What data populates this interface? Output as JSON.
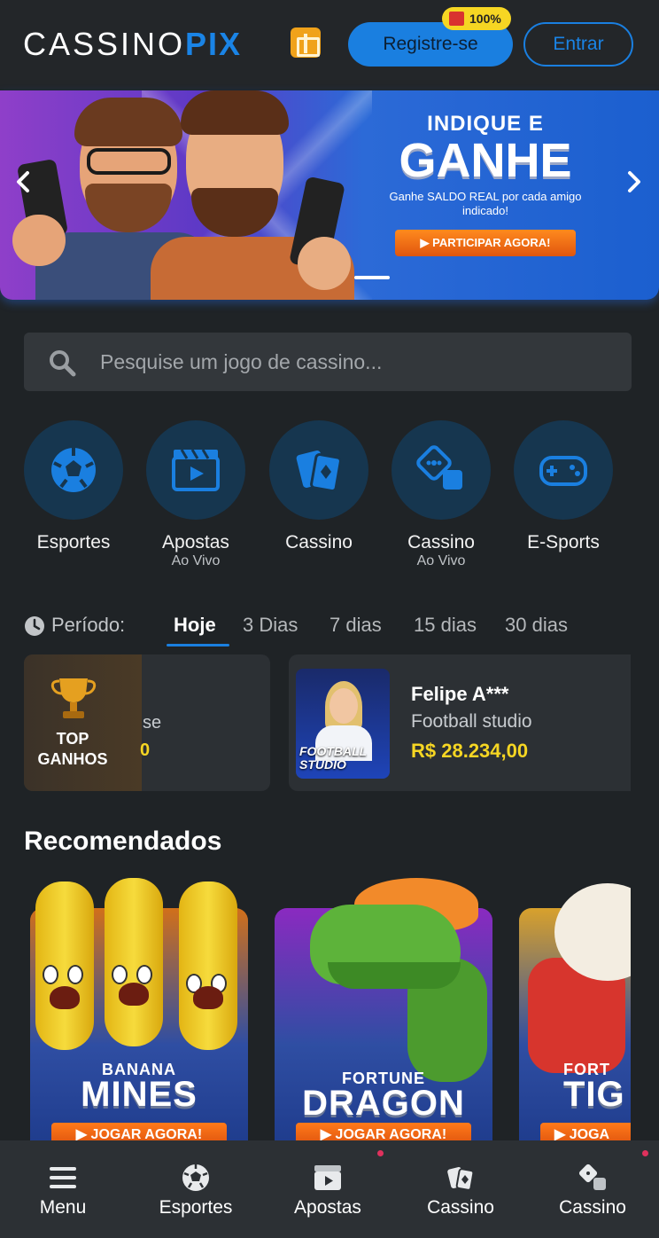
{
  "header": {
    "logo_part1": "CASSINO",
    "logo_part2": "PIX",
    "register_label": "Registre-se",
    "register_badge": "100%",
    "login_label": "Entrar"
  },
  "banner": {
    "title_line1": "INDIQUE E",
    "title_line2": "GANHE",
    "subtitle": "Ganhe SALDO REAL por cada amigo indicado!",
    "cta": "▶ PARTICIPAR AGORA!"
  },
  "search": {
    "placeholder": "Pesquise um jogo de cassino..."
  },
  "categories": [
    {
      "label": "Esportes",
      "sub": "",
      "icon": "soccer-ball-icon"
    },
    {
      "label": "Apostas",
      "sub": "Ao Vivo",
      "icon": "video-clapper-icon"
    },
    {
      "label": "Cassino",
      "sub": "",
      "icon": "playing-cards-icon"
    },
    {
      "label": "Cassino",
      "sub": "Ao Vivo",
      "icon": "dice-icon"
    },
    {
      "label": "E-Sports",
      "sub": "",
      "icon": "gamepad-icon"
    }
  ],
  "period": {
    "label": "Período:",
    "tabs": [
      "Hoje",
      "3 Dias",
      "7 dias",
      "15 dias",
      "30 dias"
    ],
    "active": "Hoje"
  },
  "winners": {
    "top_label": "TOP GANHOS",
    "partial_game": "se",
    "partial_amount": "0",
    "items": [
      {
        "name": "Felipe A***",
        "game": "Football studio",
        "amount": "R$ 28.234,00",
        "thumb_text": "FOOTBALL STUDIO"
      }
    ]
  },
  "recommended": {
    "title": "Recomendados",
    "games": [
      {
        "line1": "BANANA",
        "line2": "MINES",
        "cta": "▶ JOGAR AGORA!"
      },
      {
        "line1": "FORTUNE",
        "line2": "DRAGON",
        "cta": "▶ JOGAR AGORA!"
      },
      {
        "line1": "FORT",
        "line2": "TIG",
        "cta": "▶ JOGA"
      }
    ]
  },
  "bottom_nav": [
    {
      "label": "Menu",
      "icon": "hamburger-menu-icon"
    },
    {
      "label": "Esportes",
      "icon": "soccer-ball-icon"
    },
    {
      "label": "Apostas",
      "icon": "video-clapper-icon"
    },
    {
      "label": "Cassino",
      "icon": "playing-cards-icon"
    },
    {
      "label": "Cassino",
      "icon": "dice-icon"
    }
  ],
  "colors": {
    "accent": "#1a7fe0",
    "background": "#1f2326",
    "win_amount": "#f6d623",
    "cta_orange": "#ff7a1a"
  }
}
